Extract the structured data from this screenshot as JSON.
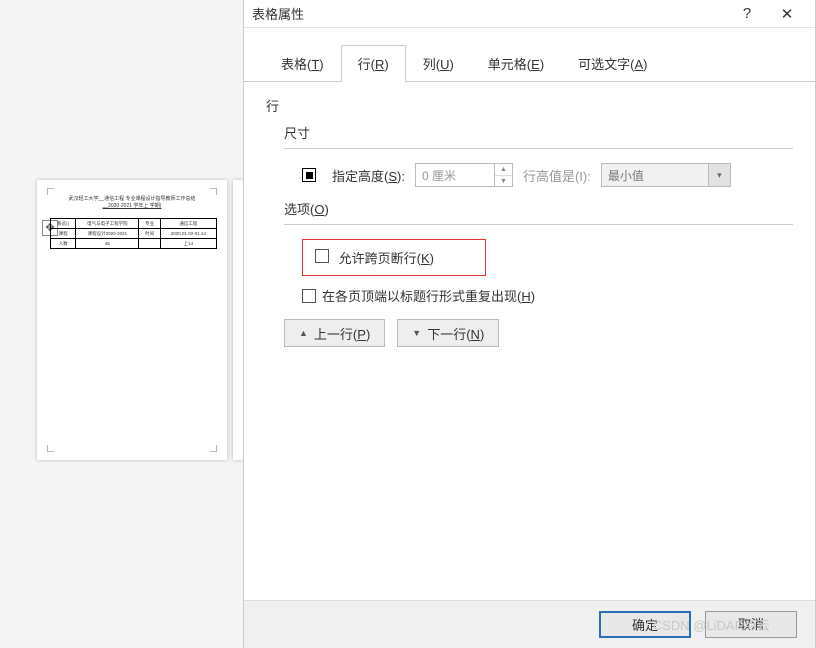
{
  "dialog": {
    "title": "表格属性",
    "help_icon": "?",
    "close_icon": "✕",
    "tabs": {
      "table": "表格(T)",
      "row": "行(R)",
      "column": "列(U)",
      "cell": "单元格(E)",
      "alt": "可选文字(A)"
    },
    "active_tab": "row"
  },
  "row_pane": {
    "heading": "行",
    "size_label": "尺寸",
    "specify_height": "指定高度(S):",
    "height_value": "0 厘米",
    "row_height_is": "行高值是(I):",
    "row_height_rule": "最小值",
    "options_label": "选项(O)",
    "allow_break": "允许跨页断行(K)",
    "repeat_header": "在各页顶端以标题行形式重复出现(H)",
    "prev_row": "上一行(P)",
    "next_row": "下一行(N)"
  },
  "footer": {
    "ok": "确定",
    "cancel": "取消"
  },
  "doc": {
    "line1": "武汉轻工大学__通信工程  专业课程设计指导教师工作总结",
    "line2": "__2020-2021 学年上 学期)",
    "t": {
      "r1c1": "系(队)",
      "r1c2": "电气与电子工程学院",
      "r1c3": "专业",
      "r1c4": "通信工程",
      "r2c1": "课程",
      "r2c2": "课程设计2020-2021",
      "r2c3": "时间",
      "r2c4": "2020.01.02-01.14",
      "r3c1": "人数",
      "r3c2": "45",
      "r3c3": "",
      "r3c4": "上14"
    }
  },
  "watermark": "CSDN @LiDAR点云"
}
